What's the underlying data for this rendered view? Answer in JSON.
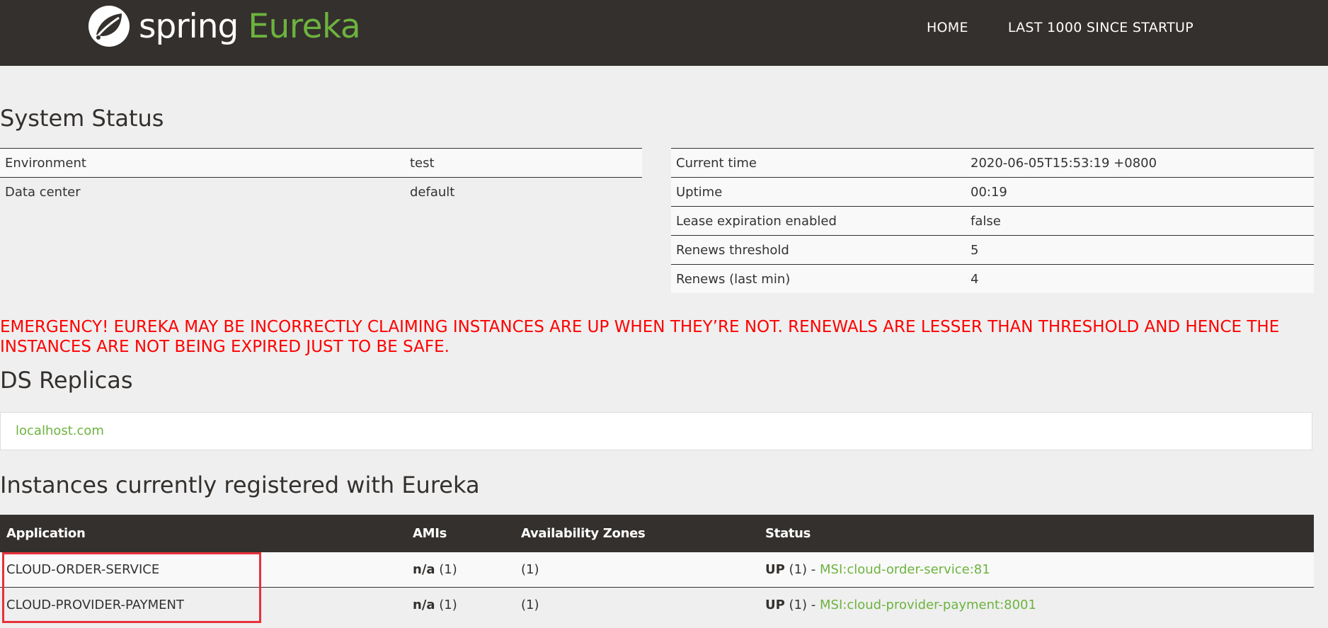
{
  "header": {
    "brand_spring": "spring",
    "brand_eureka": "Eureka",
    "nav": [
      "HOME",
      "LAST 1000 SINCE STARTUP"
    ]
  },
  "system_status": {
    "title": "System Status",
    "left": [
      {
        "key": "Environment",
        "value": "test"
      },
      {
        "key": "Data center",
        "value": "default"
      }
    ],
    "right": [
      {
        "key": "Current time",
        "value": "2020-06-05T15:53:19 +0800"
      },
      {
        "key": "Uptime",
        "value": "00:19"
      },
      {
        "key": "Lease expiration enabled",
        "value": "false"
      },
      {
        "key": "Renews threshold",
        "value": "5"
      },
      {
        "key": "Renews (last min)",
        "value": "4"
      }
    ]
  },
  "emergency": "EMERGENCY! EUREKA MAY BE INCORRECTLY CLAIMING INSTANCES ARE UP WHEN THEY’RE NOT. RENEWALS ARE LESSER THAN THRESHOLD AND HENCE THE INSTANCES ARE NOT BEING EXPIRED JUST TO BE SAFE.",
  "replicas": {
    "title": "DS Replicas",
    "items": [
      "localhost.com"
    ]
  },
  "instances": {
    "title": "Instances currently registered with Eureka",
    "columns": [
      "Application",
      "AMIs",
      "Availability Zones",
      "Status"
    ],
    "rows": [
      {
        "application": "CLOUD-ORDER-SERVICE",
        "amis_bold": "n/a",
        "amis_count": "(1)",
        "zones": "(1)",
        "status_bold": "UP",
        "status_count": "(1) - ",
        "instance_link": "MSI:cloud-order-service:81"
      },
      {
        "application": "CLOUD-PROVIDER-PAYMENT",
        "amis_bold": "n/a",
        "amis_count": "(1)",
        "zones": "(1)",
        "status_bold": "UP",
        "status_count": "(1) - ",
        "instance_link": "MSI:cloud-provider-payment:8001"
      }
    ]
  },
  "colors": {
    "header_bg": "#34302d",
    "accent_green": "#6db33f",
    "emergency_red": "#ff0000",
    "highlight_red": "#e8313a"
  }
}
